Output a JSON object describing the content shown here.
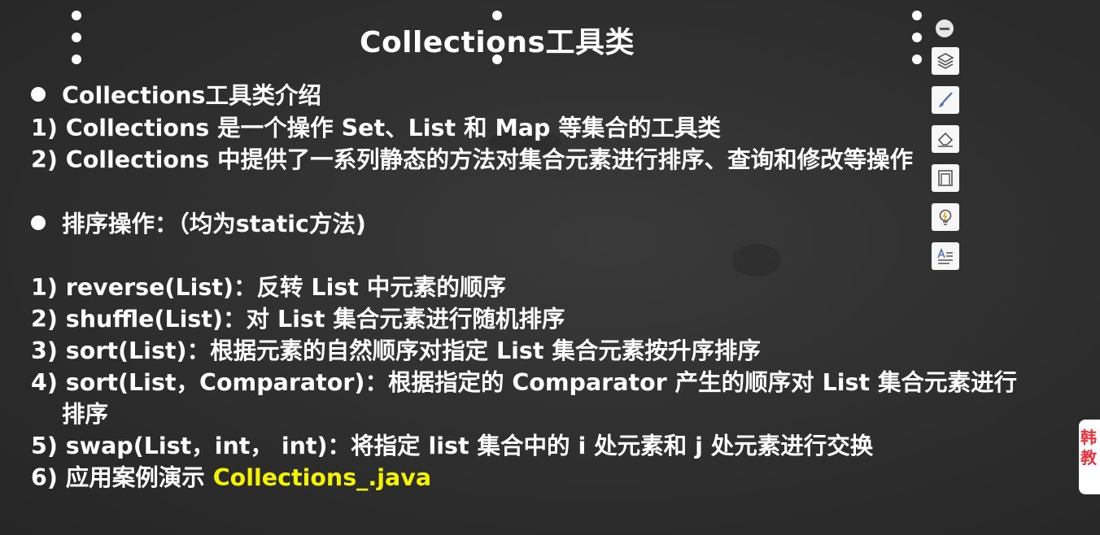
{
  "slide": {
    "title": "Collections工具类",
    "lines": [
      {
        "type": "bullet",
        "text": "Collections工具类介绍"
      },
      {
        "type": "text",
        "text": "1) Collections 是一个操作 Set、List 和 Map 等集合的工具类"
      },
      {
        "type": "text",
        "text": "2) Collections 中提供了一系列静态的方法对集合元素进行排序、查询和修改等操作"
      },
      {
        "type": "bullet",
        "text": "排序操作：（均为static方法)"
      },
      {
        "type": "text",
        "text": "1) reverse(List)：反转 List 中元素的顺序"
      },
      {
        "type": "text",
        "text": "2) shuffle(List)：对 List 集合元素进行随机排序"
      },
      {
        "type": "text",
        "text": "3) sort(List)：根据元素的自然顺序对指定 List 集合元素按升序排序"
      },
      {
        "type": "text",
        "text": "4) sort(List，Comparator)：根据指定的 Comparator 产生的顺序对 List 集合元素进行"
      },
      {
        "type": "text",
        "text": "排序"
      },
      {
        "type": "text",
        "text": "5) swap(List，int， int)：将指定 list 集合中的 i 处元素和 j 处元素进行交换"
      },
      {
        "type": "text",
        "text": "6) 应用案例演示 "
      }
    ],
    "highlight_text": "Collections_.java",
    "highlight_color": "#f4f400",
    "background_color": "#2e2e2e",
    "text_color": "#ffffff"
  },
  "toolbar": {
    "tools": [
      {
        "name": "collapse-icon"
      },
      {
        "name": "layers-icon"
      },
      {
        "name": "brush-icon"
      },
      {
        "name": "eraser-icon"
      },
      {
        "name": "frame-icon"
      },
      {
        "name": "lightbulb-icon"
      },
      {
        "name": "text-format-icon"
      }
    ]
  },
  "side_tab": {
    "text": "韩教",
    "color": "#e8323c"
  }
}
